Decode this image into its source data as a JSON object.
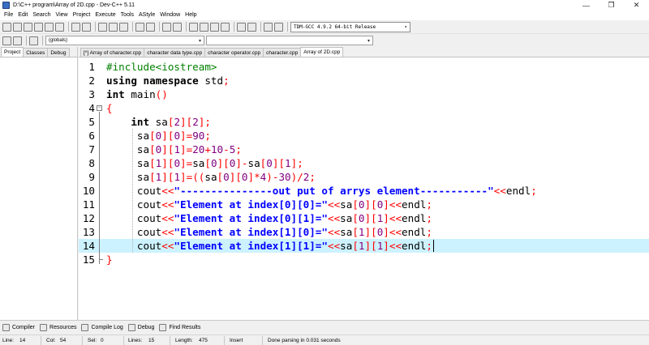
{
  "window": {
    "title": "D:\\C++ program\\Array of 2D.cpp - Dev-C++ 5.11",
    "minimize_glyph": "—",
    "maximize_glyph": "❐",
    "close_glyph": "✕"
  },
  "menu": [
    "File",
    "Edit",
    "Search",
    "View",
    "Project",
    "Execute",
    "Tools",
    "AStyle",
    "Window",
    "Help"
  ],
  "toolbar": {
    "compiler": "TDM-GCC 4.9.2 64-bit Release",
    "scope": "(globals)",
    "function": ""
  },
  "left_panel": {
    "tabs": [
      "Project",
      "Classes",
      "Debug"
    ]
  },
  "file_tabs": [
    "[*] Array of character.cpp",
    "character data type.cpp",
    "character operator.cpp",
    "character.cpp",
    "Array of 2D.cpp"
  ],
  "active_file_tab": 4,
  "editor": {
    "current_line": 14,
    "lines": [
      [
        [
          "pp",
          "#include<iostream>"
        ]
      ],
      [
        [
          "kw",
          "using namespace"
        ],
        [
          "id",
          " std"
        ],
        [
          "sym",
          ";"
        ]
      ],
      [
        [
          "tp",
          "int"
        ],
        [
          "id",
          " main"
        ],
        [
          "sym",
          "()"
        ]
      ],
      [
        [
          "sym",
          "{"
        ]
      ],
      [
        [
          "id",
          "    "
        ],
        [
          "tp",
          "int"
        ],
        [
          "id",
          " sa"
        ],
        [
          "sym",
          "["
        ],
        [
          "num",
          "2"
        ],
        [
          "sym",
          "]["
        ],
        [
          "num",
          "2"
        ],
        [
          "sym",
          "];"
        ]
      ],
      [
        [
          "id",
          "     sa"
        ],
        [
          "sym",
          "["
        ],
        [
          "num",
          "0"
        ],
        [
          "sym",
          "]["
        ],
        [
          "num",
          "0"
        ],
        [
          "sym",
          "]="
        ],
        [
          "num",
          "90"
        ],
        [
          "sym",
          ";"
        ]
      ],
      [
        [
          "id",
          "     sa"
        ],
        [
          "sym",
          "["
        ],
        [
          "num",
          "0"
        ],
        [
          "sym",
          "]["
        ],
        [
          "num",
          "1"
        ],
        [
          "sym",
          "]="
        ],
        [
          "num",
          "20"
        ],
        [
          "sym",
          "+"
        ],
        [
          "num",
          "10"
        ],
        [
          "sym",
          "-"
        ],
        [
          "num",
          "5"
        ],
        [
          "sym",
          ";"
        ]
      ],
      [
        [
          "id",
          "     sa"
        ],
        [
          "sym",
          "["
        ],
        [
          "num",
          "1"
        ],
        [
          "sym",
          "]["
        ],
        [
          "num",
          "0"
        ],
        [
          "sym",
          "]="
        ],
        [
          "id",
          "sa"
        ],
        [
          "sym",
          "["
        ],
        [
          "num",
          "0"
        ],
        [
          "sym",
          "]["
        ],
        [
          "num",
          "0"
        ],
        [
          "sym",
          "]-"
        ],
        [
          "id",
          "sa"
        ],
        [
          "sym",
          "["
        ],
        [
          "num",
          "0"
        ],
        [
          "sym",
          "]["
        ],
        [
          "num",
          "1"
        ],
        [
          "sym",
          "];"
        ]
      ],
      [
        [
          "id",
          "     sa"
        ],
        [
          "sym",
          "["
        ],
        [
          "num",
          "1"
        ],
        [
          "sym",
          "]["
        ],
        [
          "num",
          "1"
        ],
        [
          "sym",
          "]=(("
        ],
        [
          "id",
          "sa"
        ],
        [
          "sym",
          "["
        ],
        [
          "num",
          "0"
        ],
        [
          "sym",
          "]["
        ],
        [
          "num",
          "0"
        ],
        [
          "sym",
          "]*"
        ],
        [
          "num",
          "4"
        ],
        [
          "sym",
          ")-"
        ],
        [
          "num",
          "30"
        ],
        [
          "sym",
          ")/"
        ],
        [
          "num",
          "2"
        ],
        [
          "sym",
          ";"
        ]
      ],
      [
        [
          "id",
          "     cout"
        ],
        [
          "sym",
          "<<"
        ],
        [
          "str",
          "\"---------------out put of arrys element-----------\""
        ],
        [
          "sym",
          "<<"
        ],
        [
          "id",
          "endl"
        ],
        [
          "sym",
          ";"
        ]
      ],
      [
        [
          "id",
          "     cout"
        ],
        [
          "sym",
          "<<"
        ],
        [
          "str",
          "\"Element at index[0][0]=\""
        ],
        [
          "sym",
          "<<"
        ],
        [
          "id",
          "sa"
        ],
        [
          "sym",
          "["
        ],
        [
          "num",
          "0"
        ],
        [
          "sym",
          "]["
        ],
        [
          "num",
          "0"
        ],
        [
          "sym",
          "]<<"
        ],
        [
          "id",
          "endl"
        ],
        [
          "sym",
          ";"
        ]
      ],
      [
        [
          "id",
          "     cout"
        ],
        [
          "sym",
          "<<"
        ],
        [
          "str",
          "\"Element at index[0][1]=\""
        ],
        [
          "sym",
          "<<"
        ],
        [
          "id",
          "sa"
        ],
        [
          "sym",
          "["
        ],
        [
          "num",
          "0"
        ],
        [
          "sym",
          "]["
        ],
        [
          "num",
          "1"
        ],
        [
          "sym",
          "]<<"
        ],
        [
          "id",
          "endl"
        ],
        [
          "sym",
          ";"
        ]
      ],
      [
        [
          "id",
          "     cout"
        ],
        [
          "sym",
          "<<"
        ],
        [
          "str",
          "\"Element at index[1][0]=\""
        ],
        [
          "sym",
          "<<"
        ],
        [
          "id",
          "sa"
        ],
        [
          "sym",
          "["
        ],
        [
          "num",
          "1"
        ],
        [
          "sym",
          "]["
        ],
        [
          "num",
          "0"
        ],
        [
          "sym",
          "]<<"
        ],
        [
          "id",
          "endl"
        ],
        [
          "sym",
          ";"
        ]
      ],
      [
        [
          "id",
          "     cout"
        ],
        [
          "sym",
          "<<"
        ],
        [
          "str",
          "\"Element at index[1][1]=\""
        ],
        [
          "sym",
          "<<"
        ],
        [
          "id",
          "sa"
        ],
        [
          "sym",
          "["
        ],
        [
          "num",
          "1"
        ],
        [
          "sym",
          "]["
        ],
        [
          "num",
          "1"
        ],
        [
          "sym",
          "]<<"
        ],
        [
          "id",
          "endl"
        ],
        [
          "sym",
          ";"
        ]
      ],
      [
        [
          "sym",
          "}"
        ]
      ]
    ]
  },
  "bottom_tabs": [
    "Compiler",
    "Resources",
    "Compile Log",
    "Debug",
    "Find Results"
  ],
  "status": {
    "line_label": "Line:",
    "line": "14",
    "col_label": "Col:",
    "col": "54",
    "sel_label": "Sel:",
    "sel": "0",
    "lines_label": "Lines:",
    "lines": "15",
    "length_label": "Length:",
    "length": "475",
    "mode": "Insert",
    "message": "Done parsing in 0.031 seconds"
  },
  "colors": {
    "keyword": "#000000",
    "preprocessor": "#008000",
    "symbol": "#ff0000",
    "number": "#800080",
    "string": "#0000ff",
    "current_line": "#ccf2ff"
  }
}
